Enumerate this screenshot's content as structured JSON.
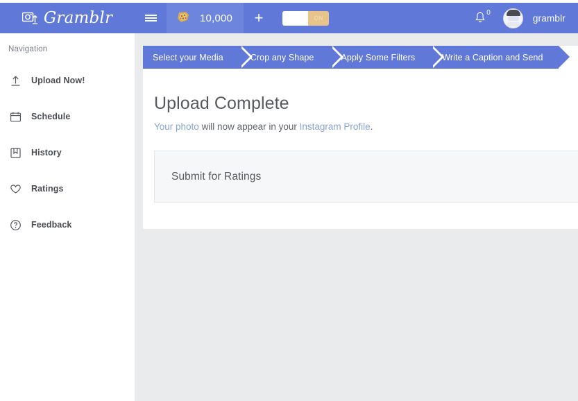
{
  "brand": {
    "name": "Gramblr",
    "icon": "camera-upload-icon"
  },
  "header": {
    "menu_icon": "hamburger-menu-icon",
    "coins": {
      "icon": "cookie-coin-icon",
      "count": "10,000",
      "add_label": "+"
    },
    "toggle": {
      "icon": "toggle-switch",
      "on_label": "ON"
    },
    "notifications": {
      "icon": "bell-icon",
      "badge": "0"
    },
    "account": {
      "avatar": "user-avatar",
      "username": "gramblr"
    }
  },
  "sidebar": {
    "title": "Navigation",
    "items": [
      {
        "label": "Upload Now!",
        "icon": "upload-arrow-icon"
      },
      {
        "label": "Schedule",
        "icon": "calendar-icon"
      },
      {
        "label": "History",
        "icon": "book-icon"
      },
      {
        "label": "Ratings",
        "icon": "heart-icon"
      },
      {
        "label": "Feedback",
        "icon": "question-circle-icon"
      }
    ]
  },
  "steps": [
    {
      "label": "Select your Media"
    },
    {
      "label": "Crop any Shape"
    },
    {
      "label": "Apply Some Filters"
    },
    {
      "label": "Write a Caption and Send"
    }
  ],
  "main": {
    "title": "Upload Complete",
    "subtitle": {
      "link1": "Your photo",
      "middle": " will now appear in your ",
      "link2": "Instagram Profile",
      "end": "."
    },
    "ratings_panel": {
      "title": "Submit for Ratings"
    }
  },
  "colors": {
    "header_blue": "#6078d8",
    "step_blue": "#6078d8",
    "link_blue": "#88a3d6",
    "toggle_gold": "#e8c48b",
    "page_bg": "#eaebec"
  }
}
